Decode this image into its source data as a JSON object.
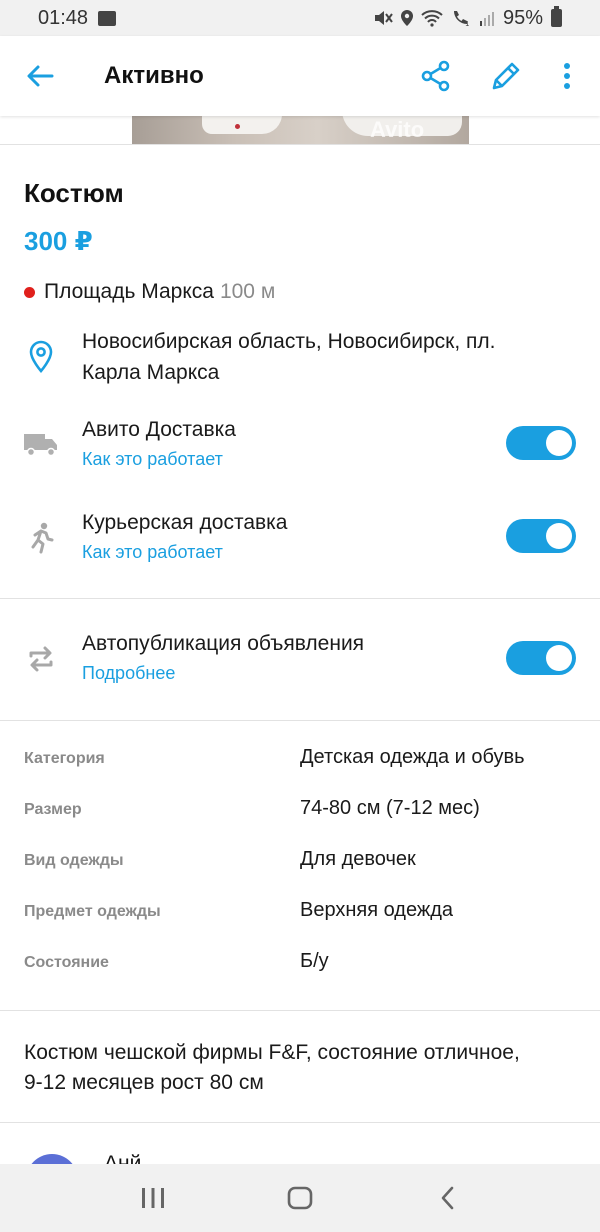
{
  "status_bar": {
    "time": "01:48",
    "battery": "95%"
  },
  "app_bar": {
    "title": "Активно"
  },
  "photo": {
    "watermark": "Avito"
  },
  "listing": {
    "title": "Костюм",
    "price": "300 ₽",
    "metro": {
      "station": "Площадь Маркса",
      "distance": "100 м",
      "color": "#e0201c"
    },
    "address_line1": "Новосибирская область, Новосибирск, пл.",
    "address_line2": "Карла Маркса"
  },
  "delivery": {
    "avito": {
      "label": "Авито Доставка",
      "link": "Как это работает",
      "enabled": true
    },
    "courier": {
      "label": "Курьерская доставка",
      "link": "Как это работает",
      "enabled": true
    }
  },
  "autopublish": {
    "label": "Автопубликация объявления",
    "link": "Подробнее",
    "enabled": true
  },
  "params": [
    {
      "key": "Категория",
      "value": "Детская одежда и обувь"
    },
    {
      "key": "Размер",
      "value": "74-80 см (7-12 мес)"
    },
    {
      "key": "Вид одежды",
      "value": "Для девочек"
    },
    {
      "key": "Предмет одежды",
      "value": "Верхняя одежда"
    },
    {
      "key": "Состояние",
      "value": "Б/у"
    }
  ],
  "description_line1": "Костюм чешской фирмы F&F, состояние отличное,",
  "description_line2": "9-12 месяцев рост 80 см",
  "seller": {
    "name_partial": "Анй"
  },
  "colors": {
    "accent": "#1a9fe0",
    "text": "#1a1a1a",
    "muted": "#8a8a8a"
  },
  "icons": {
    "back": "arrow-left-icon",
    "share": "share-icon",
    "edit": "pencil-icon",
    "more": "more-vertical-icon",
    "location": "location-pin-icon",
    "truck": "truck-icon",
    "courier": "runner-icon",
    "autopublish": "repeat-icon"
  }
}
